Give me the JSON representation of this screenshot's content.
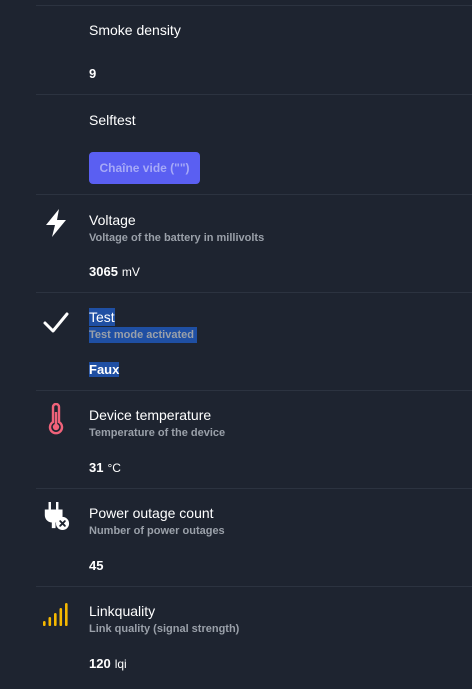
{
  "rows": [
    {
      "title": "Smoke density",
      "value": "9"
    },
    {
      "title": "Selftest",
      "button_label": "Chaîne vide (\"\")"
    },
    {
      "icon": "lightning-icon",
      "title": "Voltage",
      "description": "Voltage of the battery in millivolts",
      "value": "3065",
      "unit": "mV"
    },
    {
      "icon": "checkmark-icon",
      "title": "Test",
      "description": "Test mode activated",
      "value": "Faux"
    },
    {
      "icon": "thermometer-icon",
      "title": "Device temperature",
      "description": "Temperature of the device",
      "value": "31",
      "unit": "°C"
    },
    {
      "icon": "power-plug-off-icon",
      "title": "Power outage count",
      "description": "Number of power outages",
      "value": "45"
    },
    {
      "icon": "signal-strength-icon",
      "title": "Linkquality",
      "description": "Link quality (signal strength)",
      "value": "120",
      "unit": "lqi"
    }
  ],
  "colors": {
    "background": "#1e2430",
    "divider": "#2c3340",
    "accent_button": "#5a5ff2",
    "selection_highlight": "#1f4fa3",
    "thermometer": "#f0627a",
    "signal": "#f5b800"
  }
}
